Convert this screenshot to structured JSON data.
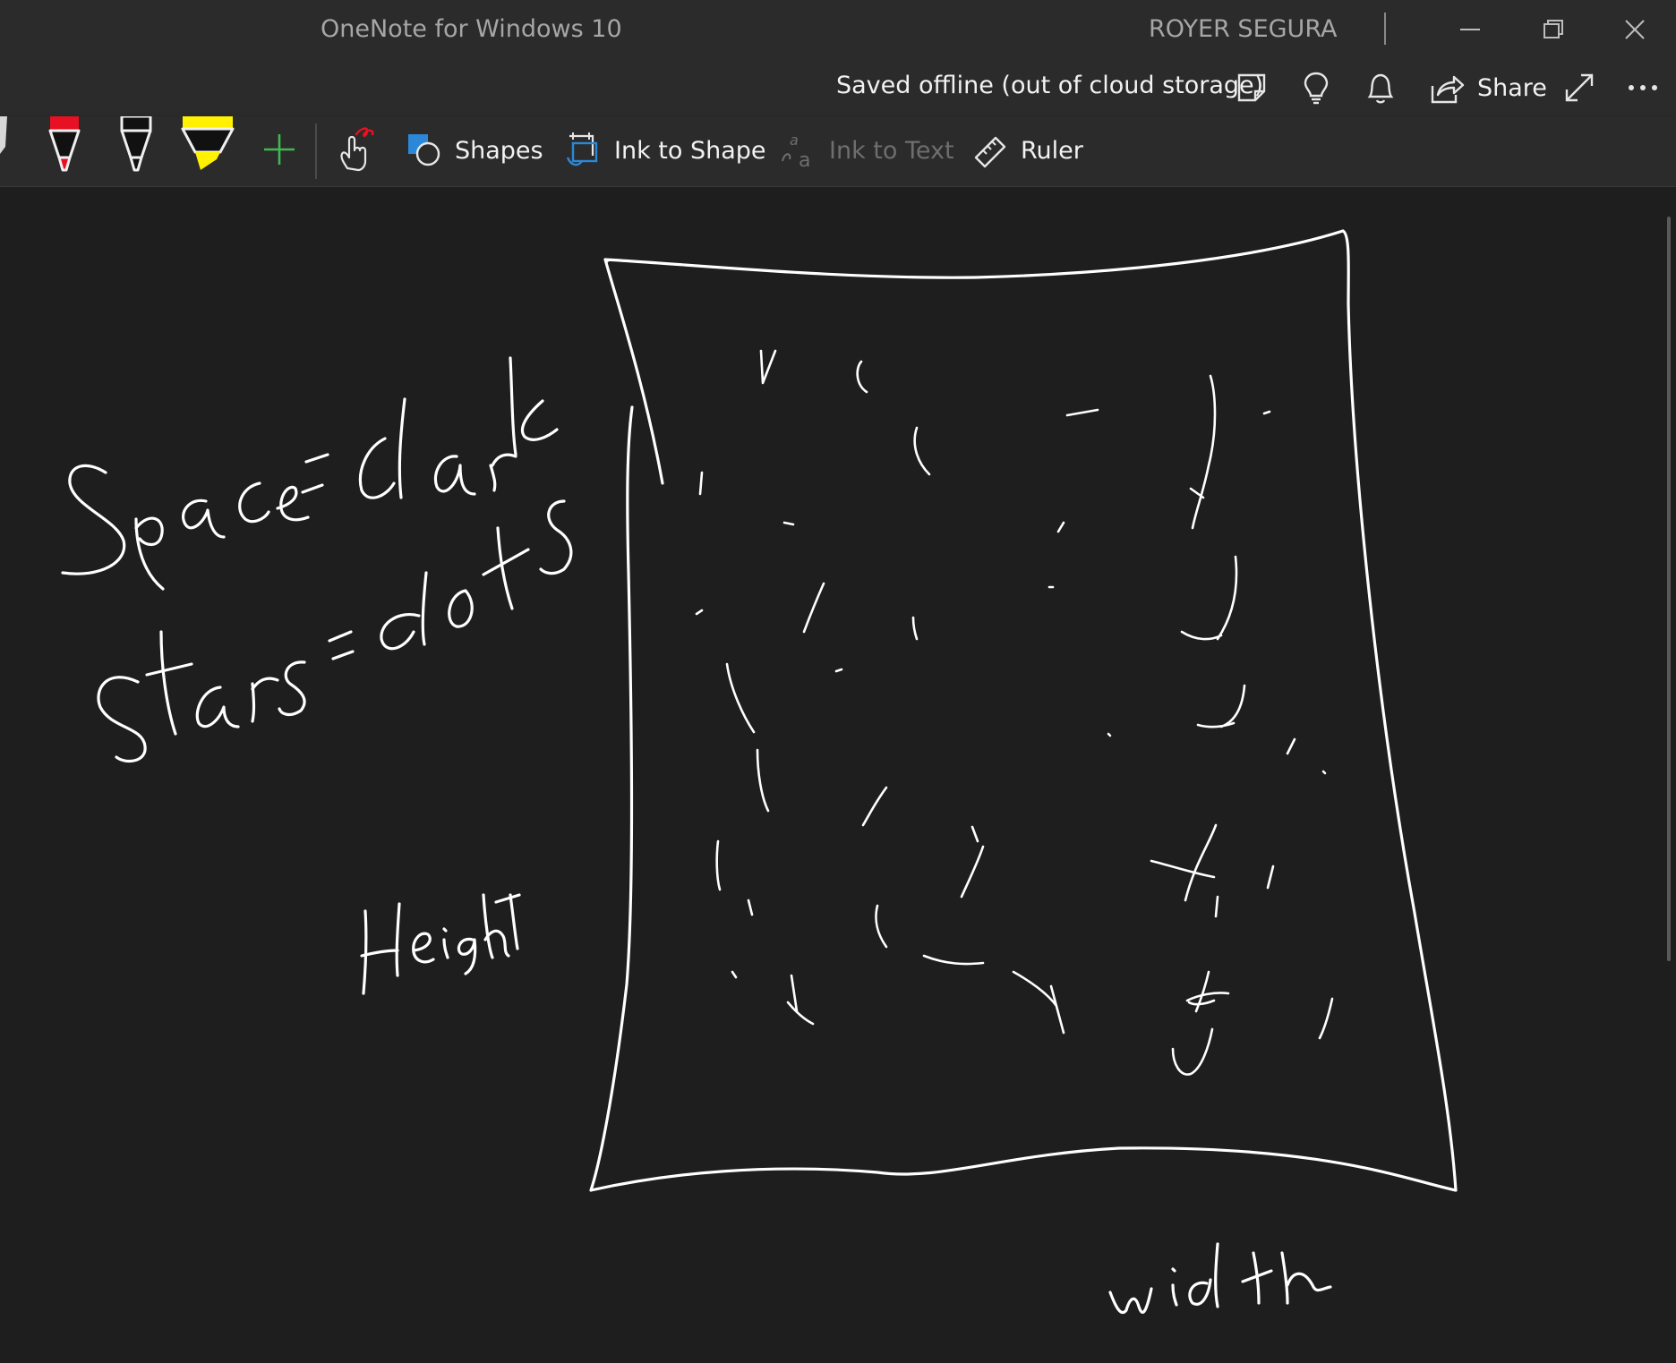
{
  "window": {
    "title": "OneNote for Windows 10",
    "user": "ROYER SEGURA"
  },
  "command_bar": {
    "status": "Saved offline (out of cloud storage)",
    "share_label": "Share",
    "icons": [
      "sticky-notes-icon",
      "tell-me-lightbulb-icon",
      "notifications-bell-icon",
      "share-icon",
      "full-screen-icon",
      "more-options-icon"
    ]
  },
  "ribbon": {
    "pens": [
      {
        "name": "red-pen",
        "color": "#e81123"
      },
      {
        "name": "black-pen",
        "color": "#000000"
      },
      {
        "name": "yellow-highlighter",
        "color": "#fff100"
      }
    ],
    "add_pen_color": "#3fb950",
    "tools": {
      "shapes": "Shapes",
      "ink_to_shape": "Ink to Shape",
      "ink_to_text": "Ink to Text",
      "ruler": "Ruler"
    }
  },
  "canvas": {
    "ink_notes": [
      "Space = dark",
      "Stars = dots",
      "Height",
      "width"
    ]
  }
}
